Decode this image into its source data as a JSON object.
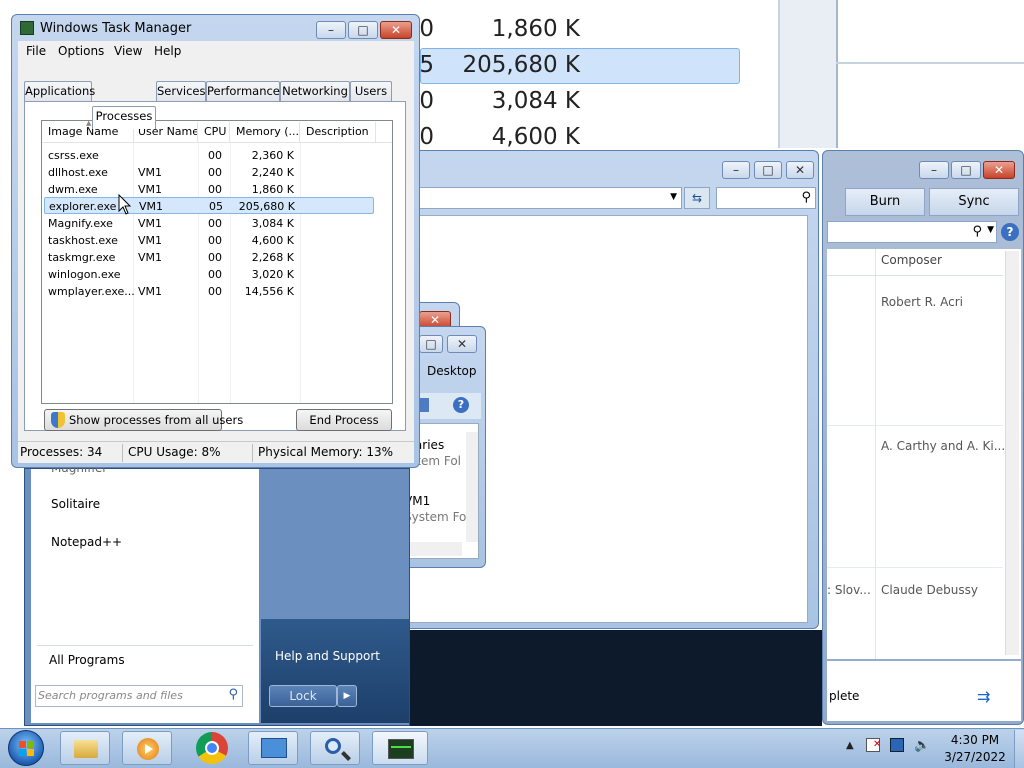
{
  "magnifier": {
    "left_digits": [
      "0",
      "5",
      "0",
      "0"
    ],
    "values": [
      "1,860 K",
      "205,680 K",
      "3,084 K",
      "4,600 K"
    ]
  },
  "media_player": {
    "tabs": [
      "Burn",
      "Sync"
    ],
    "column_composer": "Composer",
    "composers": [
      "Robert R. Acri",
      "A. Carthy and A. Ki...",
      "Claude Debussy"
    ],
    "partial_text": ": Slov...",
    "bottom_text": "plete"
  },
  "explorer": {
    "desktop_tab": "Desktop",
    "items": [
      {
        "name": "raries",
        "sub": "stem Fol"
      },
      {
        "name": "VM1",
        "sub": "System Fol"
      }
    ]
  },
  "start_menu": {
    "programs": [
      "Magnifier",
      "Solitaire",
      "Notepad++"
    ],
    "all_programs": "All Programs",
    "search_placeholder": "Search programs and files",
    "help_support": "Help and Support",
    "lock_label": "Lock"
  },
  "task_manager": {
    "title": "Windows Task Manager",
    "menu": [
      "File",
      "Options",
      "View",
      "Help"
    ],
    "tabs": [
      "Applications",
      "Processes",
      "Services",
      "Performance",
      "Networking",
      "Users"
    ],
    "active_tab": "Processes",
    "columns": [
      "Image Name",
      "User Name",
      "CPU",
      "Memory (...",
      "Description"
    ],
    "rows": [
      {
        "image": "csrss.exe",
        "user": "",
        "cpu": "00",
        "mem": "2,360 K",
        "desc": ""
      },
      {
        "image": "dllhost.exe",
        "user": "VM1",
        "cpu": "00",
        "mem": "2,240 K",
        "desc": ""
      },
      {
        "image": "dwm.exe",
        "user": "VM1",
        "cpu": "00",
        "mem": "1,860 K",
        "desc": ""
      },
      {
        "image": "explorer.exe",
        "user": "VM1",
        "cpu": "05",
        "mem": "205,680 K",
        "desc": ""
      },
      {
        "image": "Magnify.exe",
        "user": "VM1",
        "cpu": "00",
        "mem": "3,084 K",
        "desc": ""
      },
      {
        "image": "taskhost.exe",
        "user": "VM1",
        "cpu": "00",
        "mem": "4,600 K",
        "desc": ""
      },
      {
        "image": "taskmgr.exe",
        "user": "VM1",
        "cpu": "00",
        "mem": "2,268 K",
        "desc": ""
      },
      {
        "image": "winlogon.exe",
        "user": "",
        "cpu": "00",
        "mem": "3,020 K",
        "desc": ""
      },
      {
        "image": "wmplayer.exe...",
        "user": "VM1",
        "cpu": "00",
        "mem": "14,556 K",
        "desc": ""
      }
    ],
    "selected_row": "explorer.exe",
    "show_all_button": "Show processes from all users",
    "end_process_button": "End Process",
    "status": {
      "processes": "Processes: 34",
      "cpu": "CPU Usage: 8%",
      "memory": "Physical Memory: 13%"
    }
  },
  "tray": {
    "time": "4:30 PM",
    "date": "3/27/2022"
  },
  "colors": {
    "selection": "#d5e7fb",
    "glass": "#a9c3e4",
    "close": "#c8432b",
    "taskbar": "#9ab8dc"
  },
  "icons": [
    "start-orb-icon",
    "explorer-taskbar-icon",
    "media-player-taskbar-icon",
    "chrome-taskbar-icon",
    "control-panel-taskbar-icon",
    "magnifier-taskbar-icon",
    "task-manager-taskbar-icon",
    "shield-icon",
    "search-icon",
    "help-icon",
    "refresh-icon",
    "folder-icon",
    "user-folder-icon",
    "mouse-cursor-icon"
  ]
}
